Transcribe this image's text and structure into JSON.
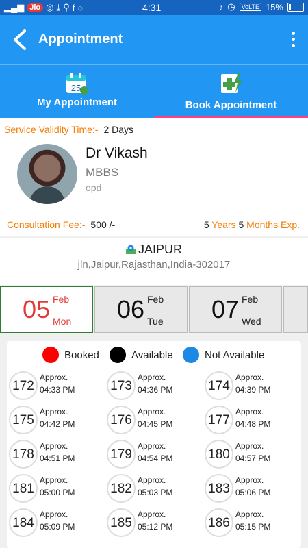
{
  "status_bar": {
    "carrier": "Jio",
    "time": "4:31",
    "volte": "VoLTE",
    "battery": "15%"
  },
  "app_bar": {
    "title": "Appointment"
  },
  "tabs": [
    {
      "label": "My Appointment",
      "icon": "calendar-icon",
      "active": false
    },
    {
      "label": "Book Appointment",
      "icon": "medical-calendar-icon",
      "active": true
    }
  ],
  "doctor": {
    "validity_label": "Service Validity Time:-",
    "validity_value": "2 Days",
    "name": "Dr Vikash",
    "degree": "MBBS",
    "type": "opd",
    "fee_label": "Consultation Fee:-",
    "fee_value": "500 /-",
    "exp_years_num": "5",
    "exp_years_label": "Years",
    "exp_months_num": "5",
    "exp_months_label": "Months",
    "exp_suffix": "Exp."
  },
  "location": {
    "city": "JAIPUR",
    "address": "jln,Jaipur,Rajasthan,India-302017"
  },
  "dates": [
    {
      "day": "05",
      "month": "Feb",
      "weekday": "Mon",
      "selected": true
    },
    {
      "day": "06",
      "month": "Feb",
      "weekday": "Tue",
      "selected": false
    },
    {
      "day": "07",
      "month": "Feb",
      "weekday": "Wed",
      "selected": false
    }
  ],
  "legend": [
    {
      "label": "Booked",
      "color": "#ff0000"
    },
    {
      "label": "Available",
      "color": "#000000"
    },
    {
      "label": "Not Available",
      "color": "#1e88e5"
    }
  ],
  "slots": [
    {
      "number": "172",
      "approx": "Approx.",
      "time": "04:33 PM"
    },
    {
      "number": "173",
      "approx": "Approx.",
      "time": "04:36 PM"
    },
    {
      "number": "174",
      "approx": "Approx.",
      "time": "04:39 PM"
    },
    {
      "number": "175",
      "approx": "Approx.",
      "time": "04:42 PM"
    },
    {
      "number": "176",
      "approx": "Approx.",
      "time": "04:45 PM"
    },
    {
      "number": "177",
      "approx": "Approx.",
      "time": "04:48 PM"
    },
    {
      "number": "178",
      "approx": "Approx.",
      "time": "04:51 PM"
    },
    {
      "number": "179",
      "approx": "Approx.",
      "time": "04:54 PM"
    },
    {
      "number": "180",
      "approx": "Approx.",
      "time": "04:57 PM"
    },
    {
      "number": "181",
      "approx": "Approx.",
      "time": "05:00 PM"
    },
    {
      "number": "182",
      "approx": "Approx.",
      "time": "05:03 PM"
    },
    {
      "number": "183",
      "approx": "Approx.",
      "time": "05:06 PM"
    },
    {
      "number": "184",
      "approx": "Approx.",
      "time": "05:09 PM"
    },
    {
      "number": "185",
      "approx": "Approx.",
      "time": "05:12 PM"
    },
    {
      "number": "186",
      "approx": "Approx.",
      "time": "05:15 PM"
    }
  ]
}
